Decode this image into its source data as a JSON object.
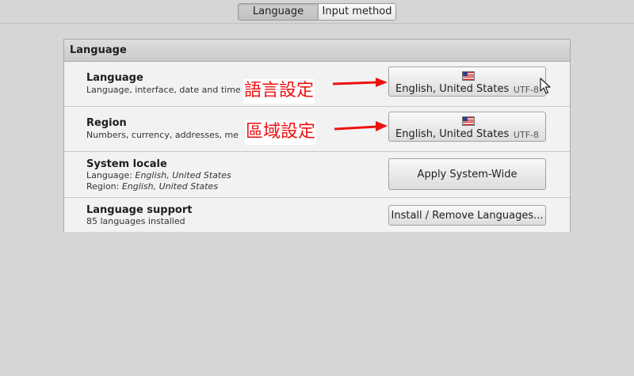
{
  "tabs": [
    {
      "label": "Language",
      "active": true
    },
    {
      "label": "Input method",
      "active": false
    }
  ],
  "panel": {
    "title": "Language",
    "rows": [
      {
        "title": "Language",
        "subtitle": "Language, interface, date and time",
        "button": {
          "icon": "us-flag-icon",
          "label": "English, United States",
          "encoding": "UTF-8"
        }
      },
      {
        "title": "Region",
        "subtitle": "Numbers, currency, addresses, me",
        "button": {
          "icon": "us-flag-icon",
          "label": "English, United States",
          "encoding": "UTF-8"
        }
      },
      {
        "title": "System locale",
        "line1_prefix": "Language: ",
        "line1_value": "English, United States",
        "line2_prefix": "Region: ",
        "line2_value": "English, United States",
        "button": {
          "label": "Apply System-Wide"
        }
      },
      {
        "title": "Language support",
        "subtitle": "85 languages installed",
        "button": {
          "label": "Install / Remove Languages..."
        }
      }
    ]
  },
  "annotations": [
    {
      "text": "語言設定"
    },
    {
      "text": "區域設定"
    }
  ],
  "colors": {
    "annotation": "#ee1111",
    "background": "#d6d6d6",
    "panel": "#f2f2f2"
  }
}
